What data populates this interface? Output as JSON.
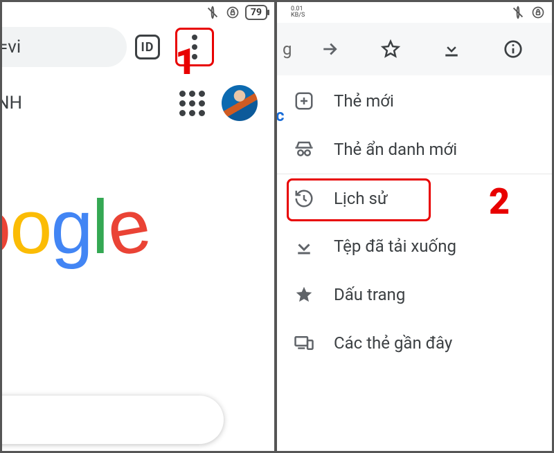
{
  "left": {
    "status": {
      "battery": "79"
    },
    "url_fragment": "n/?hl=vi",
    "tab_count": "ID",
    "row_label": "NH",
    "logo_letters": [
      "o",
      "o",
      "g",
      "l",
      "e"
    ],
    "annotation": "1"
  },
  "right": {
    "status": {
      "net_speed": "0.01",
      "net_unit": "KB/S"
    },
    "left_fragment": "g",
    "blue_letter": "c",
    "menu": [
      {
        "label": "Thẻ mới"
      },
      {
        "label": "Thẻ ẩn danh mới"
      },
      {
        "label": "Lịch sử"
      },
      {
        "label": "Tệp đã tải xuống"
      },
      {
        "label": "Dấu trang"
      },
      {
        "label": "Các thẻ gần đây"
      }
    ],
    "annotation": "2"
  }
}
